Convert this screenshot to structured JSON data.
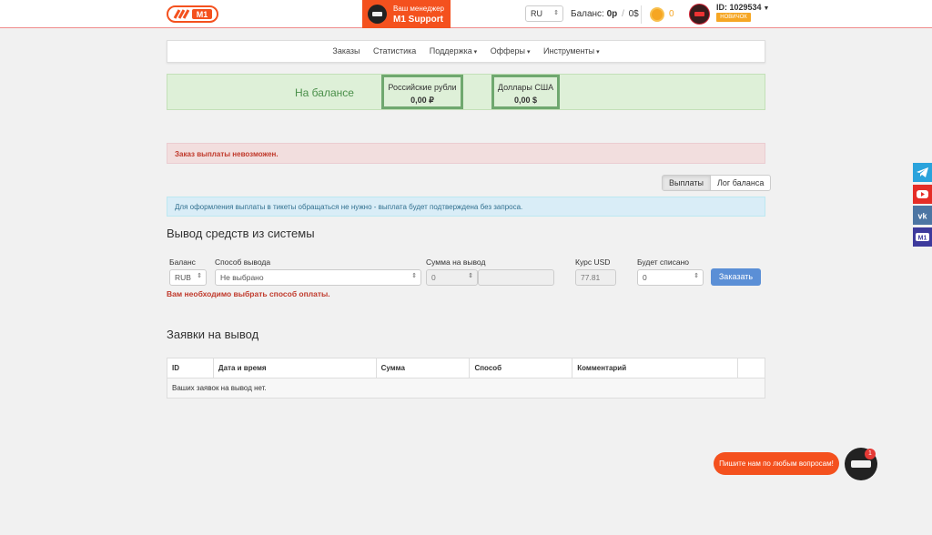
{
  "header": {
    "manager_label": "Ваш менеджер",
    "manager_name": "M1 Support",
    "lang": "RU",
    "balance_label": "Баланс:",
    "balance_rub": "0р",
    "balance_sep": "/",
    "balance_usd": "0$",
    "coins": "0",
    "user_id": "ID: 1029534",
    "user_badge": "НОВИЧОК"
  },
  "nav": {
    "items": [
      {
        "label": "Заказы"
      },
      {
        "label": "Статистика"
      },
      {
        "label": "Поддержка"
      },
      {
        "label": "Офферы"
      },
      {
        "label": "Инструменты"
      }
    ]
  },
  "balance_panel": {
    "title": "На балансе",
    "rub_currency": "Российские рубли",
    "rub_value": "0,00 ₽",
    "usd_currency": "Доллары США",
    "usd_value": "0,00 $"
  },
  "alerts": {
    "error": "Заказ выплаты невозможен.",
    "info": "Для оформления выплаты в тикеты обращаться не нужно - выплата будет подтверждена без запроса."
  },
  "tabs": {
    "payouts": "Выплаты",
    "balance_log": "Лог баланса"
  },
  "withdraw": {
    "title": "Вывод средств из системы",
    "balance_label": "Баланс",
    "balance_value": "RUB",
    "method_label": "Способ вывода",
    "method_value": "Не выбрано",
    "amount_label": "Сумма на вывод",
    "amount_value": "0",
    "rate_label": "Курс USD",
    "rate_value": "77.81",
    "debit_label": "Будет списано",
    "debit_value": "0",
    "submit": "Заказать",
    "error": "Вам необходимо выбрать способ оплаты."
  },
  "requests": {
    "title": "Заявки на вывод",
    "columns": [
      "ID",
      "Дата и время",
      "Сумма",
      "Способ",
      "Комментарий",
      ""
    ],
    "empty": "Ваших заявок на вывод нет."
  },
  "chat": {
    "prompt": "Пишите нам по любым вопросам!",
    "count": "1"
  },
  "colors": {
    "accent": "#f4511e",
    "primary_button": "#5b8fd6",
    "success_bg": "#def0d8",
    "coin": "#f6a623"
  },
  "social": [
    "telegram-icon",
    "youtube-icon",
    "vk-icon",
    "m1-icon"
  ]
}
